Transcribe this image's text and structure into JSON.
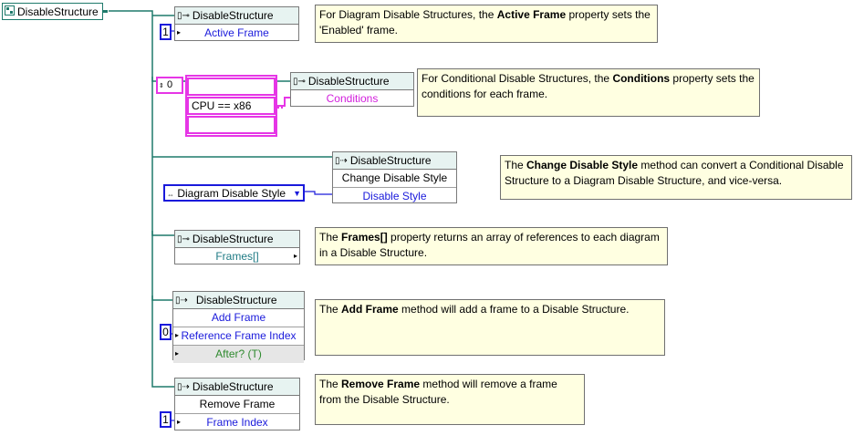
{
  "ref_control": {
    "label": "DisableStructure",
    "icon": "structure-ref-icon"
  },
  "nodes": [
    {
      "header": "DisableStructure",
      "kind": "property",
      "rows": [
        "Active Frame"
      ]
    },
    {
      "header": "DisableStructure",
      "kind": "property",
      "rows": [
        "Conditions"
      ]
    },
    {
      "header": "DisableStructure",
      "kind": "invoke",
      "rows": [
        "Change Disable Style",
        "Disable Style"
      ]
    },
    {
      "header": "DisableStructure",
      "kind": "property",
      "rows": [
        "Frames[]"
      ]
    },
    {
      "header": "DisableStructure",
      "kind": "invoke",
      "rows": [
        "Add Frame",
        "Reference Frame Index",
        "After? (T)"
      ]
    },
    {
      "header": "DisableStructure",
      "kind": "invoke",
      "rows": [
        "Remove Frame",
        "Frame Index"
      ]
    }
  ],
  "constants": {
    "active_frame": "1",
    "conditions_index": "0",
    "conditions_values": [
      "",
      "CPU == x86",
      ""
    ],
    "disable_style": "Diagram Disable Style",
    "add_frame_index": "0",
    "remove_frame_index": "1"
  },
  "comments": [
    {
      "parts": [
        "For Diagram Disable Structures, the ",
        "Active Frame",
        " property sets the 'Enabled' frame."
      ]
    },
    {
      "parts": [
        "For Conditional Disable Structures, the ",
        "Conditions",
        " property sets the conditions for each frame."
      ]
    },
    {
      "parts": [
        "The ",
        "Change Disable Style",
        " method can convert a Conditional Disable Structure to a Diagram Disable Structure, and vice-versa."
      ]
    },
    {
      "parts": [
        "The ",
        "Frames[]",
        " property returns an array of references to each diagram in a Disable Structure."
      ]
    },
    {
      "parts": [
        "The ",
        "Add Frame",
        " method will add a frame to a Disable Structure."
      ]
    },
    {
      "parts": [
        "The ",
        "Remove Frame",
        " method will remove a frame from the Disable Structure."
      ]
    }
  ],
  "colors": {
    "ref_wire": "#1e7a6b",
    "numeric_wire": "#1a1adb",
    "string_wire": "#e636e6",
    "comment_bg": "#ffffe1"
  }
}
